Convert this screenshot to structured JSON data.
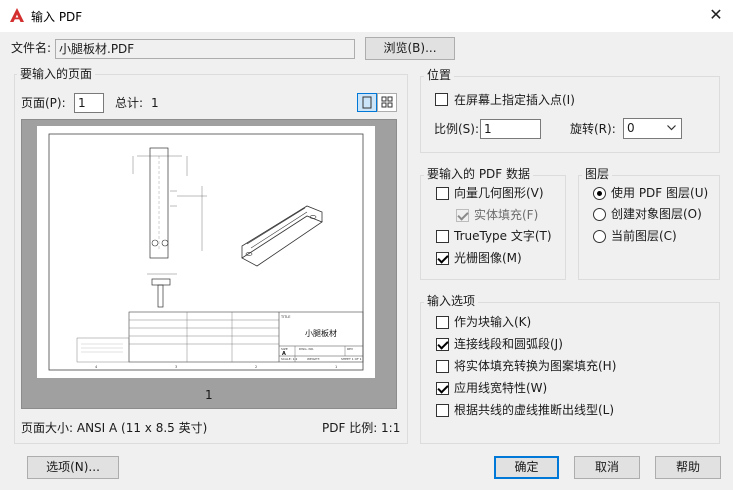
{
  "window": {
    "title": "输入 PDF",
    "close_glyph": "✕"
  },
  "file": {
    "label": "文件名:",
    "value": "小腿板材.PDF",
    "browse_label": "浏览(B)..."
  },
  "pages_group": {
    "title": "要输入的页面",
    "page_label": "页面(P):",
    "page_value": "1",
    "total_label": "总计:",
    "total_value": "1",
    "preview_page_number": "1",
    "page_size": "页面大小: ANSI A (11 x 8.5 英寸)",
    "pdf_scale": "PDF 比例: 1:1"
  },
  "position_group": {
    "title": "位置",
    "specify_on_screen": "在屏幕上指定插入点(I)",
    "specify_checked": false,
    "scale_label": "比例(S):",
    "scale_value": "1",
    "rotation_label": "旋转(R):",
    "rotation_value": "0"
  },
  "pdf_data_group": {
    "title": "要输入的 PDF 数据",
    "items": [
      {
        "label": "向量几何图形(V)",
        "checked": false,
        "disabled": false
      },
      {
        "label": "实体填充(F)",
        "checked": true,
        "disabled": true
      },
      {
        "label": "TrueType 文字(T)",
        "checked": false,
        "disabled": false
      },
      {
        "label": "光栅图像(M)",
        "checked": true,
        "disabled": false
      }
    ]
  },
  "layers_group": {
    "title": "图层",
    "items": [
      {
        "label": "使用 PDF 图层(U)",
        "checked": true
      },
      {
        "label": "创建对象图层(O)",
        "checked": false
      },
      {
        "label": "当前图层(C)",
        "checked": false
      }
    ]
  },
  "import_options_group": {
    "title": "输入选项",
    "items": [
      {
        "label": "作为块输入(K)",
        "checked": false
      },
      {
        "label": "连接线段和圆弧段(J)",
        "checked": true
      },
      {
        "label": "将实体填充转换为图案填充(H)",
        "checked": false
      },
      {
        "label": "应用线宽特性(W)",
        "checked": true
      },
      {
        "label": "根据共线的虚线推断出线型(L)",
        "checked": false
      }
    ]
  },
  "drawing": {
    "title_block_name": "小腿板材",
    "title_label": "TITLE",
    "size_label": "SIZE",
    "size_value": "A",
    "dwg_no_label": "DWG. NO.",
    "rev_label": "REV",
    "scale_text": "SCALE: 1:2",
    "weight_text": "WEIGHT:",
    "sheet_text": "SHEET 1 OF 1",
    "border_numbers": [
      "4",
      "3",
      "2",
      "1"
    ]
  },
  "buttons": {
    "options": "选项(N)...",
    "ok": "确定",
    "cancel": "取消",
    "help": "帮助"
  },
  "colors": {
    "accent": "#0078d7",
    "app_icon_red": "#d32f2f"
  }
}
